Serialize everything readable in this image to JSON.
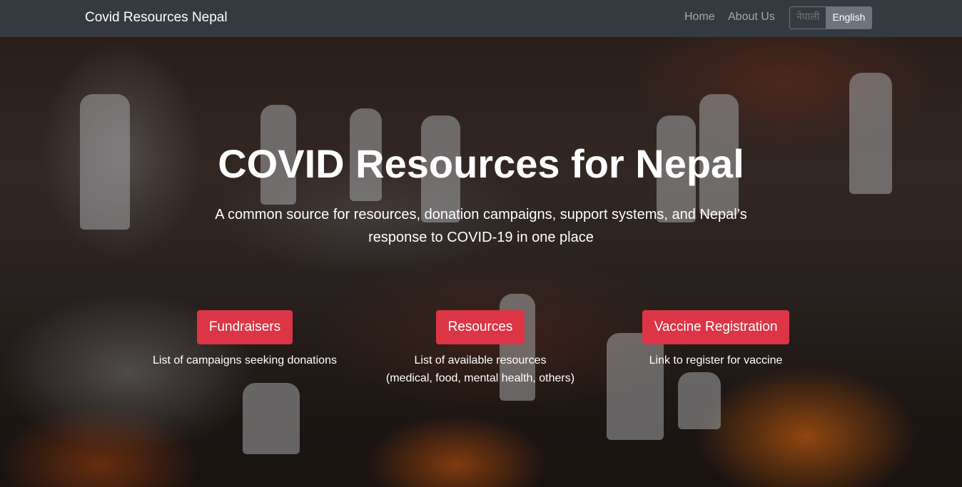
{
  "navbar": {
    "brand": "Covid Resources Nepal",
    "links": [
      "Home",
      "About Us"
    ],
    "languages": [
      {
        "label": "नेपाली",
        "active": false
      },
      {
        "label": "English",
        "active": true
      }
    ]
  },
  "hero": {
    "title": "COVID Resources for Nepal",
    "subtitle_line1": "A common source for resources, donation campaigns, support systems, and Nepal’s",
    "subtitle_line2": "response to COVID-19 in one place",
    "cards": [
      {
        "button": "Fundraisers",
        "desc_line1": "List of campaigns seeking donations",
        "desc_line2": ""
      },
      {
        "button": "Resources",
        "desc_line1": "List of available resources",
        "desc_line2": "(medical, food, mental health, others)"
      },
      {
        "button": "Vaccine Registration",
        "desc_line1": "Link to register for vaccine",
        "desc_line2": ""
      }
    ]
  },
  "colors": {
    "navbar_bg": "#343a40",
    "accent_red": "#dc3545",
    "lang_active_bg": "#6c757d"
  }
}
